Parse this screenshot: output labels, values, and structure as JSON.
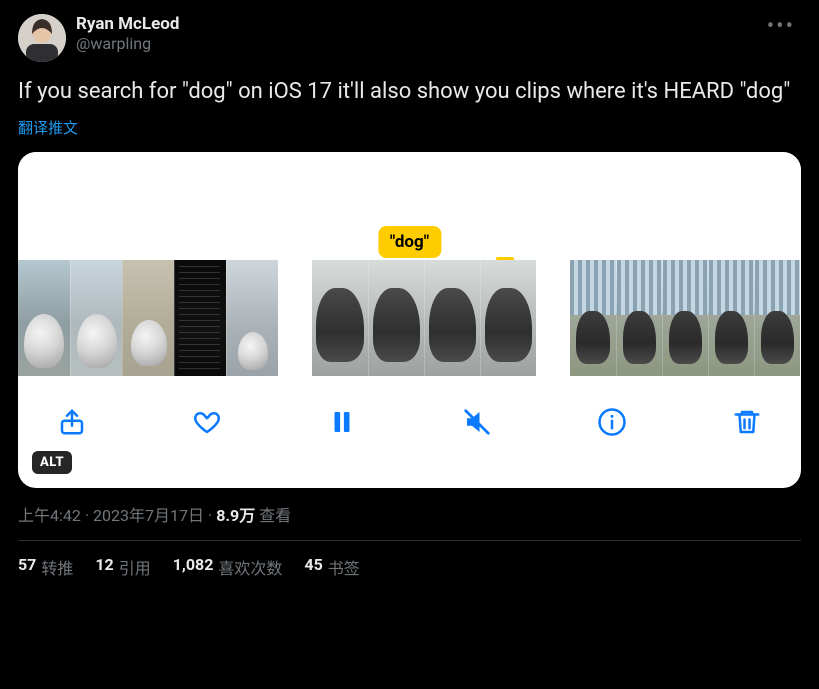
{
  "user": {
    "display_name": "Ryan McLeod",
    "handle": "@warpling"
  },
  "tweet": {
    "text": "If you search for \"dog\" on iOS 17 it'll also show you clips where it's HEARD \"dog\"",
    "translate_label": "翻译推文"
  },
  "media": {
    "tag_text": "\"dog\"",
    "alt_label": "ALT"
  },
  "meta": {
    "time": "上午4:42",
    "date": "2023年7月17日",
    "views_count": "8.9万",
    "views_label": "查看"
  },
  "stats": {
    "retweets_count": "57",
    "retweets_label": "转推",
    "quotes_count": "12",
    "quotes_label": "引用",
    "likes_count": "1,082",
    "likes_label": "喜欢次数",
    "bookmarks_count": "45",
    "bookmarks_label": "书签"
  }
}
